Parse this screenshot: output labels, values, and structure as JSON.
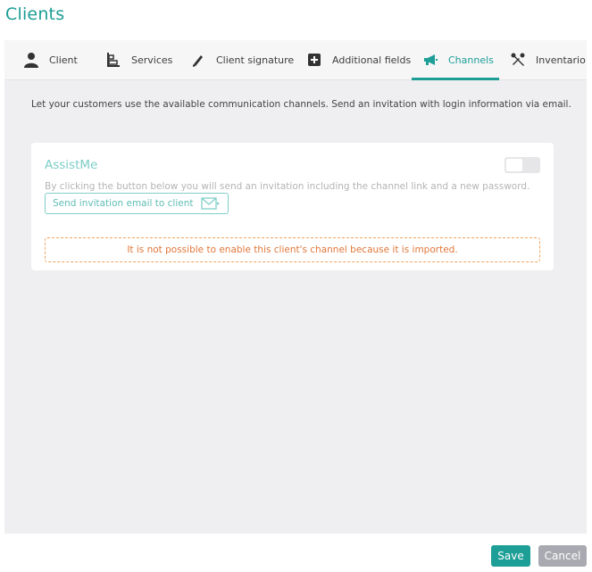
{
  "page": {
    "title": "Clients"
  },
  "tabs": [
    {
      "label": "Client",
      "icon": "user-icon",
      "active": false
    },
    {
      "label": "Services",
      "icon": "services-icon",
      "active": false
    },
    {
      "label": "Client signature",
      "icon": "pen-icon",
      "active": false
    },
    {
      "label": "Additional fields",
      "icon": "plus-box-icon",
      "active": false
    },
    {
      "label": "Channels",
      "icon": "megaphone-icon",
      "active": true
    },
    {
      "label": "Inventario",
      "icon": "tools-icon",
      "active": false
    }
  ],
  "channels": {
    "intro": "Let your customers use the available communication channels. Send an invitation with login information via email.",
    "card": {
      "title": "AssistMe",
      "toggle_enabled": false,
      "description": "By clicking the button below you will send an invitation including the channel link and a new password.",
      "invite_button": "Send invitation email to client",
      "warning": "It is not possible to enable this client's channel because it is imported."
    }
  },
  "footer": {
    "save_label": "Save",
    "cancel_label": "Cancel"
  },
  "colors": {
    "accent": "#1d9e96",
    "warning": "#e0773a",
    "cancel": "#a9aab1"
  }
}
